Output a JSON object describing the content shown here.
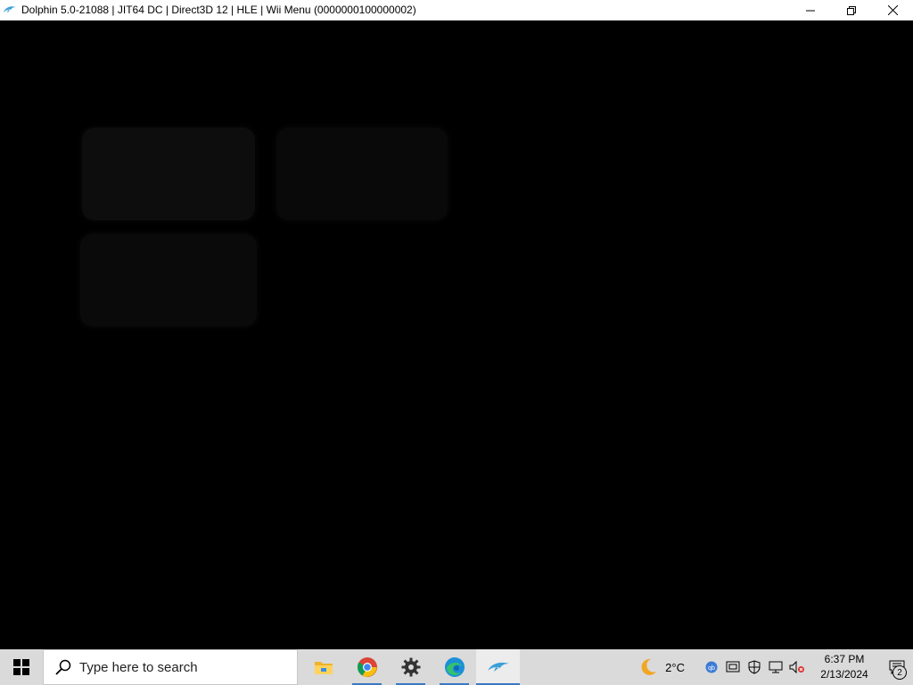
{
  "window": {
    "title": "Dolphin 5.0-21088 | JIT64 DC | Direct3D 12 | HLE | Wii Menu (0000000100000002)",
    "icon": "dolphin-icon",
    "controls": [
      "minimize-icon",
      "restore-icon",
      "close-icon"
    ]
  },
  "viewport": {
    "content": "Wii Menu (dark)",
    "channels": [
      "channel-tile-1",
      "channel-tile-2",
      "channel-tile-3"
    ]
  },
  "taskbar": {
    "start_icon": "windows-icon",
    "search_placeholder": "Type here to search",
    "apps": [
      {
        "name": "file-explorer-icon",
        "open": false
      },
      {
        "name": "chrome-icon",
        "open": true
      },
      {
        "name": "settings-gear-icon",
        "open": true
      },
      {
        "name": "edge-icon",
        "open": true
      },
      {
        "name": "dolphin-icon",
        "open": true,
        "active": true
      }
    ],
    "weather_temp": "2°C",
    "clock_time": "6:37 PM",
    "clock_date": "2/13/2024",
    "notification_count": "2",
    "accent_color": "#3a78c3"
  }
}
